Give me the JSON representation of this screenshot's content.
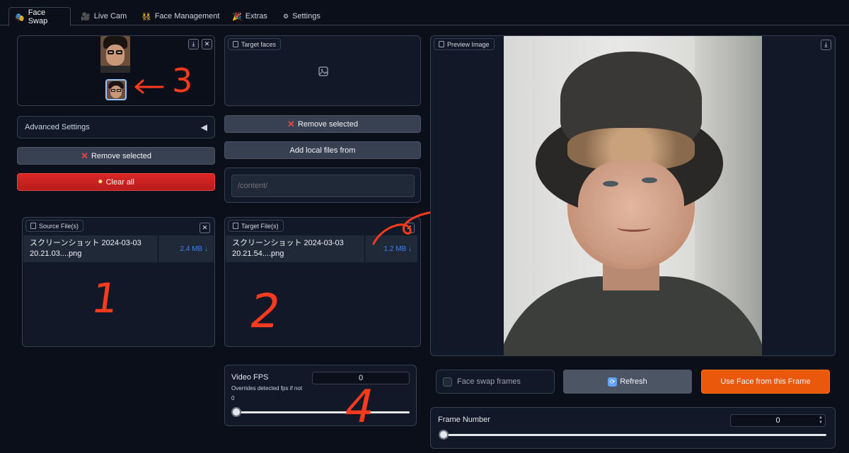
{
  "tabs": [
    {
      "label": "Face Swap",
      "icon": "theater-masks-icon",
      "active": true
    },
    {
      "label": "Live Cam",
      "icon": "video-camera-icon",
      "active": false
    },
    {
      "label": "Face Management",
      "icon": "people-icon",
      "active": false
    },
    {
      "label": "Extras",
      "icon": "party-popper-icon",
      "active": false
    },
    {
      "label": "Settings",
      "icon": "gear-icon",
      "active": false
    }
  ],
  "source_faces": {
    "thumbnail_count": 2,
    "annotation": "← 3"
  },
  "advanced_settings": {
    "label": "Advanced Settings"
  },
  "left_buttons": {
    "remove_selected": "Remove selected",
    "clear_all": "Clear all"
  },
  "source_files": {
    "label": "Source File(s)",
    "file_name_1": "スクリーンショット 2024-03-03",
    "file_name_2": "20.21.03....png",
    "file_size": "2.4 MB ↓",
    "annotation": "1"
  },
  "target_faces": {
    "label": "Target faces"
  },
  "middle_buttons": {
    "remove_selected": "Remove selected",
    "add_local": "Add local files from"
  },
  "path_input": {
    "placeholder": "/content/"
  },
  "target_files": {
    "label": "Target File(s)",
    "file_name_1": "スクリーンショット 2024-03-03",
    "file_name_2": "20.21.54....png",
    "file_size": "1.2 MB ↓",
    "annotation": "2"
  },
  "video_fps": {
    "label": "Video FPS",
    "hint": "Overrides detected fps if not",
    "hint_value": "0",
    "value": "0",
    "slider_fraction": 0,
    "annotation": "4"
  },
  "preview": {
    "label": "Preview Image"
  },
  "controls": {
    "face_swap_frames": "Face swap frames",
    "refresh": "Refresh",
    "use_face": "Use Face from this Frame"
  },
  "frame_number": {
    "label": "Frame Number",
    "value": "0",
    "slider_fraction": 0
  },
  "colors": {
    "accent_orange": "#ea580c",
    "danger_red": "#dc2626",
    "link_blue": "#3b82f6",
    "annotation_red": "#ff3b1f"
  }
}
